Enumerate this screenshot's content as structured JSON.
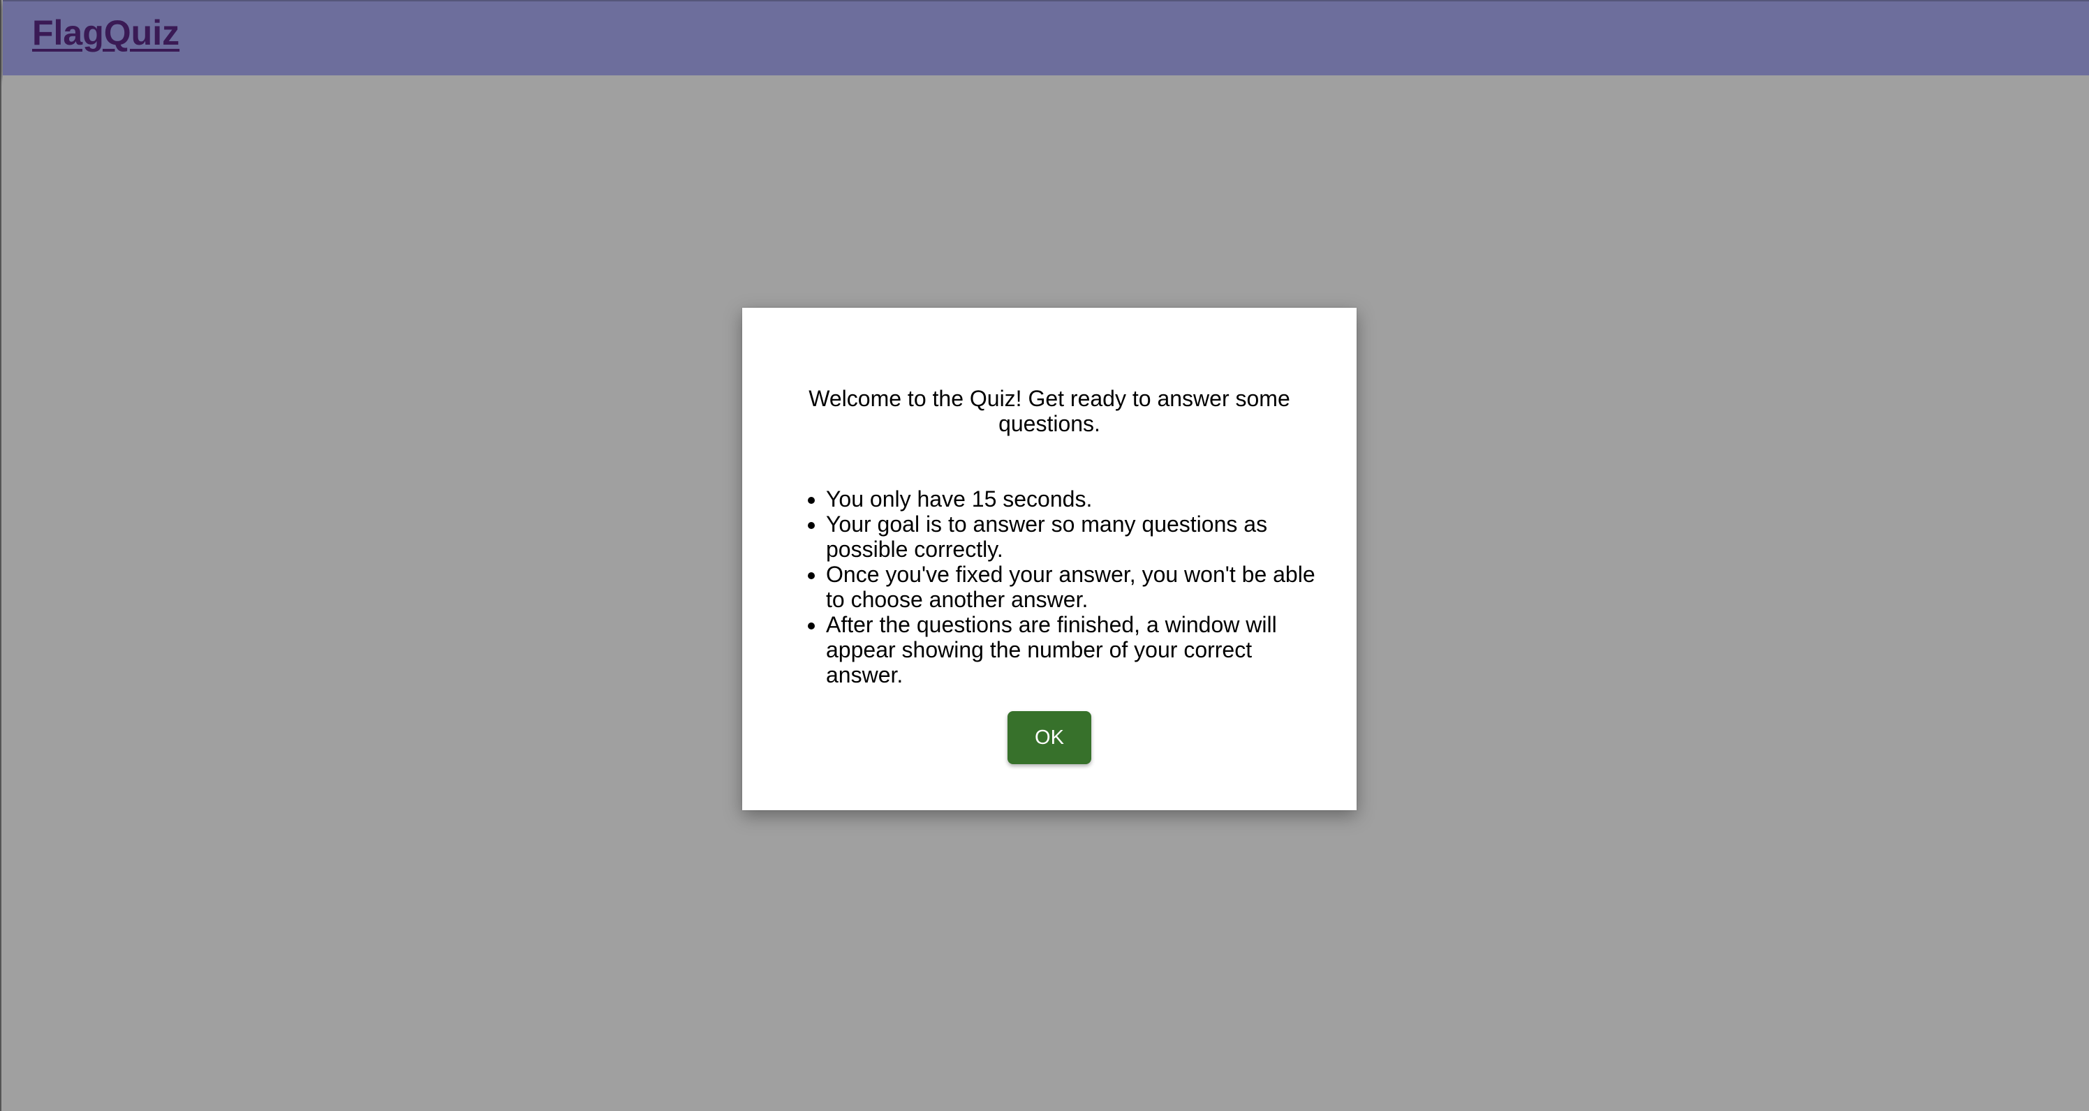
{
  "header": {
    "logo": "FlagQuiz"
  },
  "modal": {
    "title": "Welcome to the Quiz! Get ready to answer some questions.",
    "rules": [
      "You only have 15 seconds.",
      "Your goal is to answer so many questions as possible correctly.",
      "Once you've fixed your answer, you won't be able to choose another answer.",
      "After the questions are finished, a window will appear showing the number of your correct answer."
    ],
    "ok_label": "OK"
  },
  "colors": {
    "header_bg": "#6d6e9c",
    "logo": "#3a1a55",
    "backdrop": "#a0a0a0",
    "ok_button": "#37712b"
  }
}
